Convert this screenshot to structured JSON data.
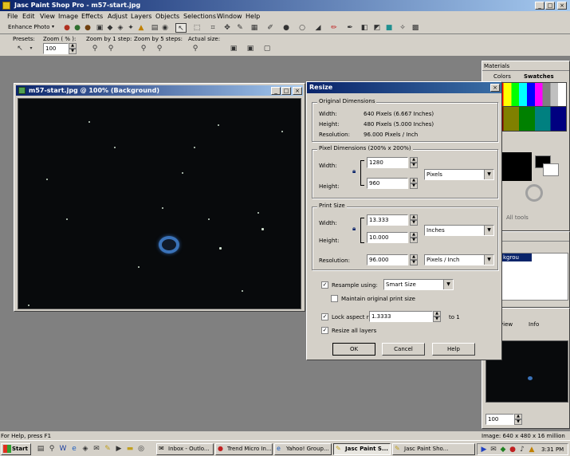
{
  "app": {
    "title": "Jasc Paint Shop Pro - m57-start.jpg"
  },
  "menu": [
    "File",
    "Edit",
    "View",
    "Image",
    "Effects",
    "Adjust",
    "Layers",
    "Objects",
    "Selections",
    "Window",
    "Help"
  ],
  "toolbar": {
    "enhance_photo": "Enhance Photo"
  },
  "tool_options": {
    "presets_label": "Presets:",
    "zoom_label": "Zoom ( % ):",
    "zoom_value": "100",
    "zoom1_label": "Zoom by 1 step:",
    "zoom5_label": "Zoom by 5 steps:",
    "actual_label": "Actual size:"
  },
  "image_window": {
    "title": "m57-start.jpg @ 100% (Background)"
  },
  "materials": {
    "title": "Materials",
    "tab_colors": "Colors",
    "tab_swatches": "Swatches",
    "all_tools": "All tools"
  },
  "overview": {
    "tab_view": "view",
    "tab_info": "Info",
    "zoom_value": "100"
  },
  "layers": {
    "item": "kgrou"
  },
  "resize": {
    "title": "Resize",
    "original": {
      "label": "Original Dimensions",
      "width_label": "Width:",
      "width_value": "640 Pixels (6.667 Inches)",
      "height_label": "Height:",
      "height_value": "480 Pixels (5.000 Inches)",
      "resolution_label": "Resolution:",
      "resolution_value": "96.000 Pixels / Inch"
    },
    "pixel": {
      "label": "Pixel Dimensions (200% x 200%)",
      "width_label": "Width:",
      "width_value": "1280",
      "height_label": "Height:",
      "height_value": "960",
      "unit": "Pixels"
    },
    "print": {
      "label": "Print Size",
      "width_label": "Width:",
      "width_value": "13.333",
      "height_label": "Height:",
      "height_value": "10.000",
      "unit": "Inches",
      "resolution_label": "Resolution:",
      "resolution_value": "96.000",
      "resolution_unit": "Pixels / Inch"
    },
    "resample_label": "Resample using:",
    "resample_value": "Smart Size",
    "maintain_label": "Maintain original print size",
    "aspect_label": "Lock aspect ratio:",
    "aspect_value": "1.3333",
    "aspect_suffix": "to 1",
    "resize_layers_label": "Resize all layers",
    "ok": "OK",
    "cancel": "Cancel",
    "help": "Help"
  },
  "status": {
    "help_text": "For Help, press F1",
    "image_info": "Image:  640 x 480 x 16 million"
  },
  "taskbar": {
    "start": "Start",
    "buttons": [
      "Inbox - Outlo...",
      "Trend Micro In...",
      "Yahoo! Group...",
      "Jasc Paint S...",
      "Jasc Paint Sho..."
    ],
    "clock": "3:31 PM"
  }
}
